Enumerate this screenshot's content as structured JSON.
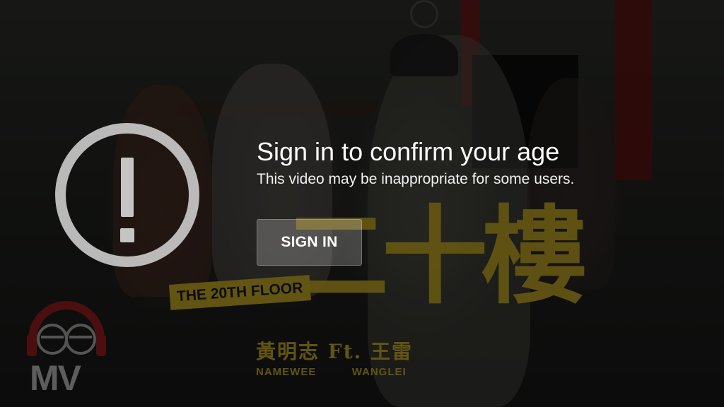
{
  "dialog": {
    "title": "Sign in to confirm your age",
    "subtitle": "This video may be inappropriate for some users.",
    "sign_in_label": "SIGN IN",
    "icon": "warning-circle-icon"
  },
  "artwork": {
    "chinese_title": "二十樓",
    "english_title": "THE 20TH FLOOR",
    "artist_line": "黃明志 Ft. 王雷",
    "artist_1": "NAMEWEE",
    "artist_2": "WANGLEI"
  },
  "logo": {
    "text": "MV"
  },
  "colors": {
    "accent_gold": "#b39a22",
    "overlay": "rgba(0,0,0,0.45)",
    "button_bg": "rgba(255,255,255,0.22)"
  }
}
